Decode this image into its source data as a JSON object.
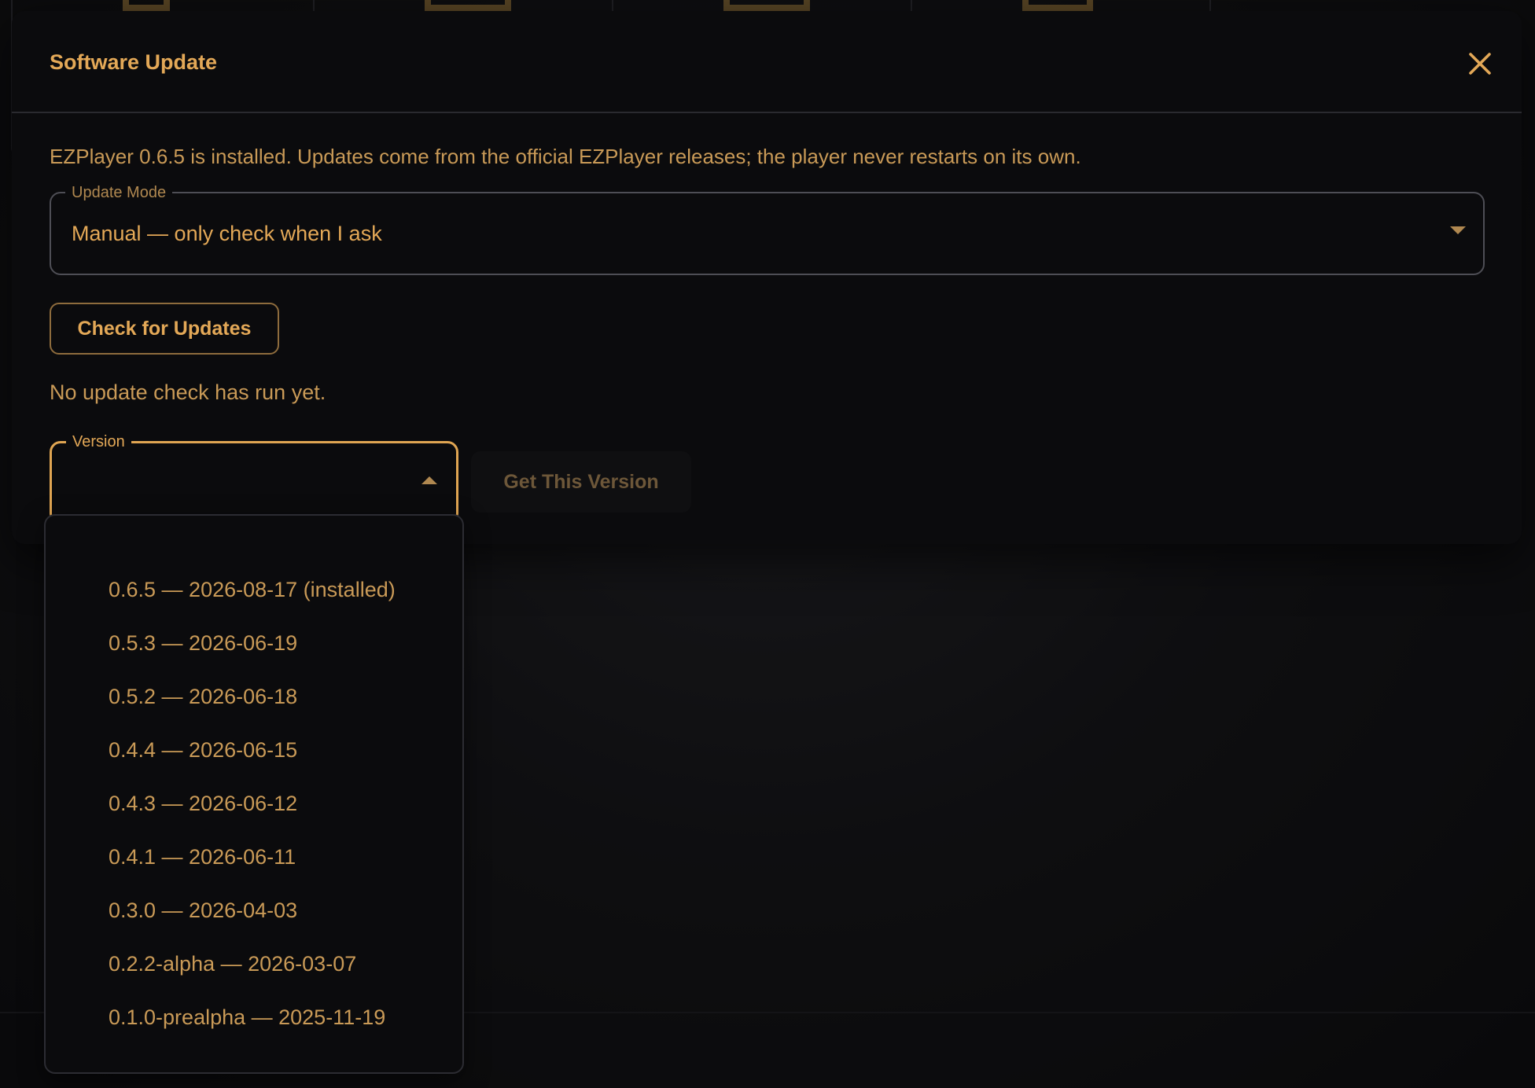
{
  "dialog": {
    "title": "Software Update",
    "intro": "EZPlayer 0.6.5 is installed. Updates come from the official EZPlayer releases; the player never restarts on its own.",
    "update_mode": {
      "label": "Update Mode",
      "value": "Manual — only check when I ask"
    },
    "check_button": "Check for Updates",
    "status": "No update check has run yet.",
    "version": {
      "label": "Version",
      "value": ""
    },
    "get_version_button": "Get This Version"
  },
  "version_menu": {
    "items": [
      "0.6.5 — 2026-08-17 (installed)",
      "0.5.3 — 2026-06-19",
      "0.5.2 — 2026-06-18",
      "0.4.4 — 2026-06-15",
      "0.4.3 — 2026-06-12",
      "0.4.1 — 2026-06-11",
      "0.3.0 — 2026-04-03",
      "0.2.2-alpha — 2026-03-07",
      "0.1.0-prealpha — 2025-11-19"
    ]
  },
  "colors": {
    "accent": "#e3a857",
    "muted_text": "#c99a57",
    "modal_bg": "#0b0b0d",
    "border": "#4e4e55"
  },
  "icons": {
    "close": "close-icon",
    "mode_dropdown": "chevron-down-icon",
    "version_dropdown": "chevron-up-icon"
  }
}
